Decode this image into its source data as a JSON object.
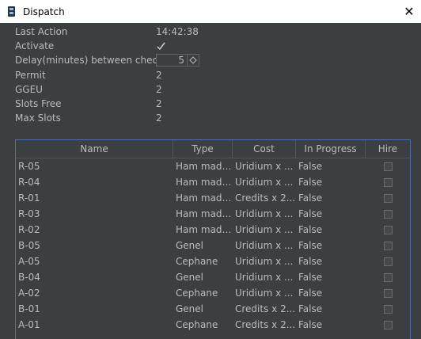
{
  "window": {
    "title": "Dispatch",
    "close_glyph": "✕"
  },
  "properties": {
    "last_action_label": "Last Action",
    "last_action_value": "14:42:38",
    "activate_label": "Activate",
    "activate_checked": true,
    "delay_label": "Delay(minutes) between checks",
    "delay_value": "5",
    "permit_label": "Permit",
    "permit_value": "2",
    "ggeu_label": "GGEU",
    "ggeu_value": "2",
    "slots_free_label": "Slots Free",
    "slots_free_value": "2",
    "max_slots_label": "Max Slots",
    "max_slots_value": "2"
  },
  "table": {
    "headers": [
      "Name",
      "Type",
      "Cost",
      "In Progress",
      "Hire"
    ],
    "rows": [
      {
        "name": "R-05",
        "type": "Ham madd...",
        "cost": "Uridium x ...",
        "in_progress": "False",
        "hire": false
      },
      {
        "name": "R-04",
        "type": "Ham madd...",
        "cost": "Uridium x ...",
        "in_progress": "False",
        "hire": false
      },
      {
        "name": "R-01",
        "type": "Ham madd...",
        "cost": "Credits x 2...",
        "in_progress": "False",
        "hire": false
      },
      {
        "name": "R-03",
        "type": "Ham madd...",
        "cost": "Uridium x ...",
        "in_progress": "False",
        "hire": false
      },
      {
        "name": "R-02",
        "type": "Ham madd...",
        "cost": "Uridium x ...",
        "in_progress": "False",
        "hire": false
      },
      {
        "name": "B-05",
        "type": "Genel",
        "cost": "Uridium x ...",
        "in_progress": "False",
        "hire": false
      },
      {
        "name": "A-05",
        "type": "Cephane",
        "cost": "Uridium x ...",
        "in_progress": "False",
        "hire": false
      },
      {
        "name": "B-04",
        "type": "Genel",
        "cost": "Uridium x ...",
        "in_progress": "False",
        "hire": false
      },
      {
        "name": "A-02",
        "type": "Cephane",
        "cost": "Uridium x ...",
        "in_progress": "False",
        "hire": false
      },
      {
        "name": "B-01",
        "type": "Genel",
        "cost": "Credits x 2...",
        "in_progress": "False",
        "hire": false
      },
      {
        "name": "A-01",
        "type": "Cephane",
        "cost": "Credits x 2...",
        "in_progress": "False",
        "hire": false
      }
    ]
  },
  "colors": {
    "background": "#3c3f41",
    "text": "#bbbbbb",
    "table_border": "#4b6eaf"
  }
}
